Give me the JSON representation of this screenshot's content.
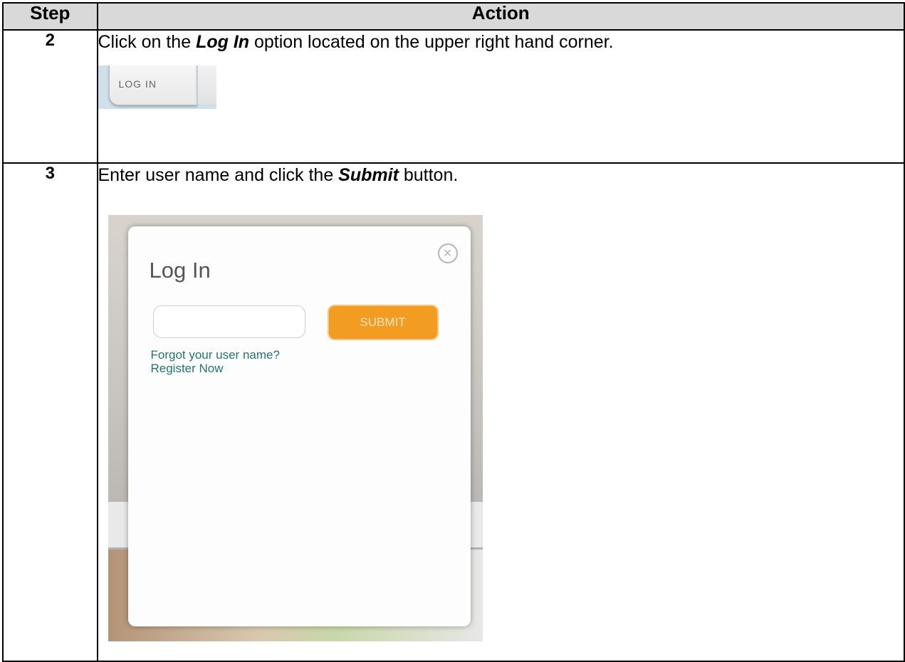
{
  "table": {
    "headers": {
      "step": "Step",
      "action": "Action"
    },
    "rows": [
      {
        "step": "2",
        "text_before": "Click on the ",
        "bold": "Log In",
        "text_after": " option located on the upper right hand corner.",
        "screenshot": {
          "tab_label": "LOG IN"
        }
      },
      {
        "step": "3",
        "text_before": "Enter user name and click the ",
        "bold": "Submit",
        "text_after": " button.",
        "screenshot": {
          "title": "Log In",
          "submit_label": "SUBMIT",
          "forgot_link": "Forgot your user name?",
          "register_link": "Register Now",
          "close_icon": "close-circle-icon"
        }
      }
    ]
  },
  "colors": {
    "header_bg": "#d9d9d9",
    "submit_bg": "#f29c22",
    "link": "#1f7676"
  }
}
